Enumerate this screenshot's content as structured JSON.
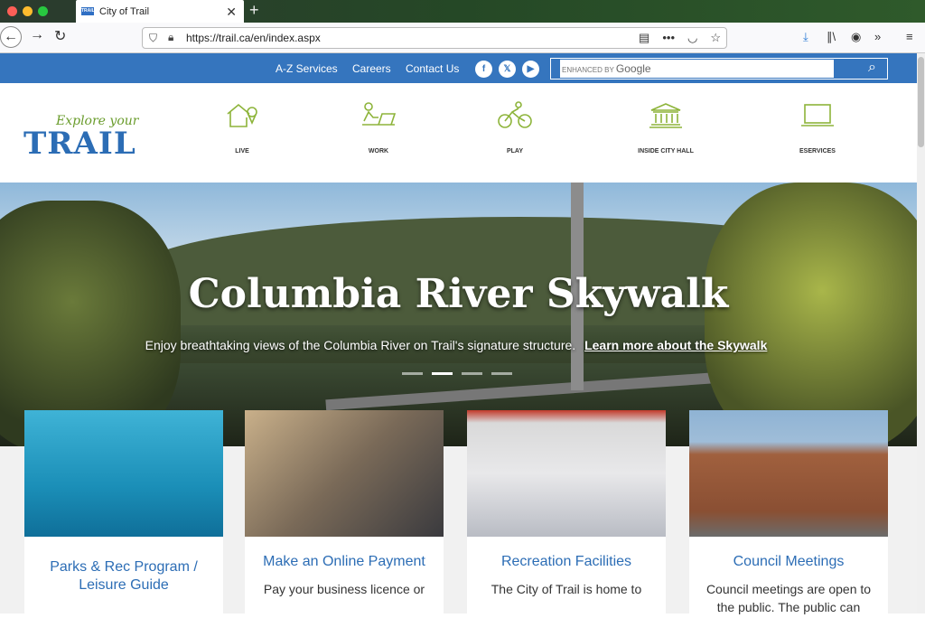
{
  "browser": {
    "tab_title": "City of Trail",
    "favicon_text": "TRAIL",
    "url": "https://trail.ca/en/index.aspx"
  },
  "topnav": {
    "links": [
      "A-Z Services",
      "Careers",
      "Contact Us"
    ],
    "social": [
      "facebook-icon",
      "x-icon",
      "youtube-icon"
    ],
    "search_prefix": "ENHANCED BY",
    "search_brand": "Google"
  },
  "logo": {
    "script": "Explore your",
    "main": "TRAIL"
  },
  "menu": [
    {
      "label": "LIVE",
      "icon": "house-location-icon"
    },
    {
      "label": "WORK",
      "icon": "person-laptop-icon"
    },
    {
      "label": "PLAY",
      "icon": "cyclist-icon"
    },
    {
      "label": "INSIDE CITY HALL",
      "icon": "city-hall-icon"
    },
    {
      "label": "ESERVICES",
      "icon": "laptop-icon"
    }
  ],
  "hero": {
    "title": "Columbia River Skywalk",
    "subtitle": "Enjoy breathtaking views of the Columbia River on Trail's signature structure.",
    "link": "Learn more about the Skywalk",
    "slides": 4,
    "active_slide": 2
  },
  "cards": [
    {
      "title": "Parks & Rec Program / Leisure Guide",
      "text": ""
    },
    {
      "title": "Make an Online Payment",
      "text": "Pay your business licence or"
    },
    {
      "title": "Recreation Facilities",
      "text": "The City of Trail is home to"
    },
    {
      "title": "Council Meetings",
      "text": "Council meetings are open to the public.  The public can"
    }
  ],
  "colors": {
    "brand_blue": "#3575be",
    "accent_green": "#8db43a",
    "link_blue": "#2c6db5"
  }
}
